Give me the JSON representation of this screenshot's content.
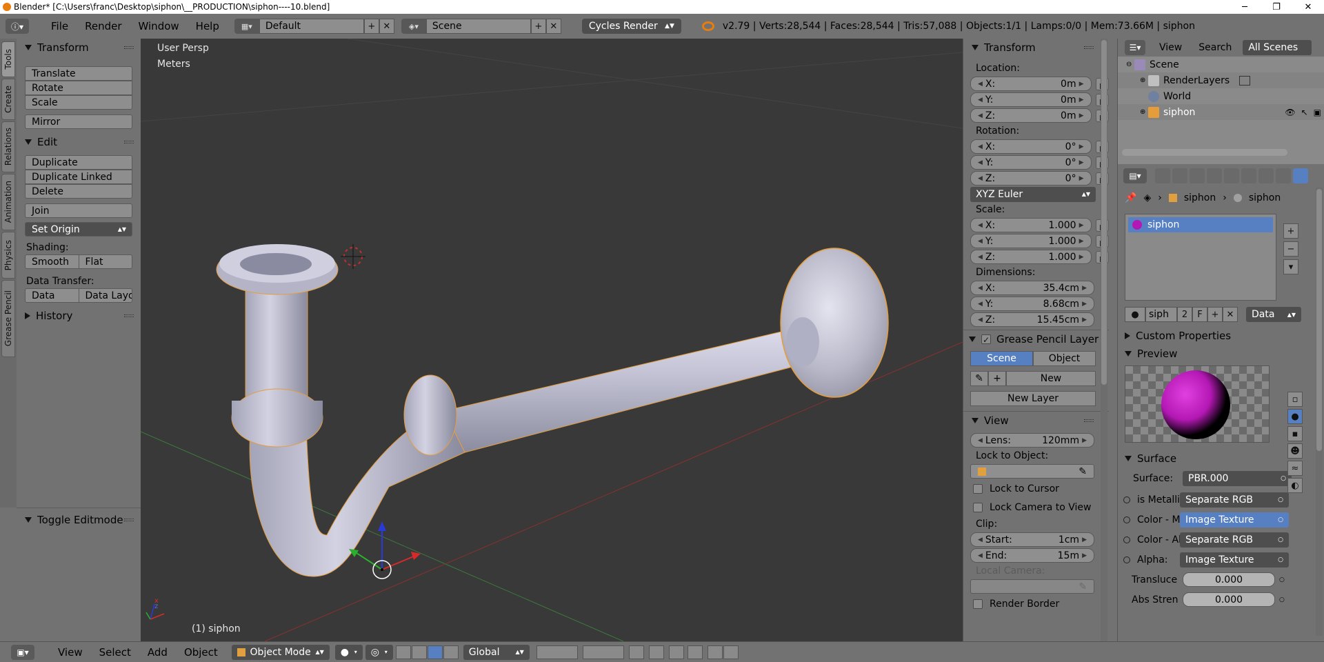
{
  "window": {
    "title": "Blender* [C:\\Users\\franc\\Desktop\\siphon\\__PRODUCTION\\siphon----10.blend]",
    "minimize": "─",
    "maximize": "❐",
    "close": "✕"
  },
  "info_header": {
    "menus": [
      "File",
      "Render",
      "Window",
      "Help"
    ],
    "screen_layout": "Default",
    "scene": "Scene",
    "render_engine": "Cycles Render",
    "stats": "v2.79 | Verts:28,544 | Faces:28,544 | Tris:57,088 | Objects:1/1 | Lamps:0/0 | Mem:73.66M | siphon"
  },
  "tool_tabs": [
    "Tools",
    "Create",
    "Relations",
    "Animation",
    "Physics",
    "Grease Pencil"
  ],
  "toolshelf": {
    "transform": {
      "title": "Transform",
      "buttons": [
        "Translate",
        "Rotate",
        "Scale",
        "Mirror"
      ]
    },
    "edit": {
      "title": "Edit",
      "buttons": [
        "Duplicate",
        "Duplicate Linked",
        "Delete",
        "Join"
      ],
      "set_origin": "Set Origin",
      "shading_label": "Shading:",
      "shading": [
        "Smooth",
        "Flat"
      ],
      "data_transfer_label": "Data Transfer:",
      "data_transfer": [
        "Data",
        "Data Layo"
      ]
    },
    "history": {
      "title": "History"
    },
    "operator": {
      "title": "Toggle Editmode"
    }
  },
  "viewport": {
    "view_name": "User Persp",
    "units": "Meters",
    "active_object": "(1) siphon",
    "axis_x": "x",
    "axis_z": "z"
  },
  "npanel": {
    "transform": {
      "title": "Transform",
      "location_label": "Location:",
      "location": [
        {
          "axis": "X:",
          "value": "0m"
        },
        {
          "axis": "Y:",
          "value": "0m"
        },
        {
          "axis": "Z:",
          "value": "0m"
        }
      ],
      "rotation_label": "Rotation:",
      "rotation": [
        {
          "axis": "X:",
          "value": "0°"
        },
        {
          "axis": "Y:",
          "value": "0°"
        },
        {
          "axis": "Z:",
          "value": "0°"
        }
      ],
      "rotation_mode": "XYZ Euler",
      "scale_label": "Scale:",
      "scale": [
        {
          "axis": "X:",
          "value": "1.000"
        },
        {
          "axis": "Y:",
          "value": "1.000"
        },
        {
          "axis": "Z:",
          "value": "1.000"
        }
      ],
      "dimensions_label": "Dimensions:",
      "dimensions": [
        {
          "axis": "X:",
          "value": "35.4cm"
        },
        {
          "axis": "Y:",
          "value": "8.68cm"
        },
        {
          "axis": "Z:",
          "value": "15.45cm"
        }
      ]
    },
    "grease_pencil": {
      "title": "Grease Pencil Layer",
      "modes": [
        "Scene",
        "Object"
      ],
      "new_label": "New",
      "new_layer": "New Layer"
    },
    "view": {
      "title": "View",
      "lens_label": "Lens:",
      "lens": "120mm",
      "lock_object_label": "Lock to Object:",
      "lock_cursor": "Lock to Cursor",
      "lock_camera": "Lock Camera to View",
      "clip_label": "Clip:",
      "clip_start_label": "Start:",
      "clip_start": "1cm",
      "clip_end_label": "End:",
      "clip_end": "15m",
      "local_camera_label": "Local Camera:",
      "render_border": "Render Border"
    }
  },
  "outliner": {
    "menus": [
      "View",
      "Search"
    ],
    "filter": "All Scenes",
    "items": [
      {
        "label": "Scene"
      },
      {
        "label": "RenderLayers"
      },
      {
        "label": "World"
      },
      {
        "label": "siphon"
      }
    ]
  },
  "properties": {
    "breadcrumb": [
      "siphon",
      "siphon"
    ],
    "slot": "siphon",
    "material_name": "siph",
    "users": "2",
    "fake_user": "F",
    "link": "Data",
    "custom_props": "Custom Properties",
    "preview": "Preview",
    "surface_panel": "Surface",
    "surface_label": "Surface:",
    "surface_value": "PBR.000",
    "inputs": [
      {
        "label": "is Metallic",
        "value": "Separate RGB",
        "type": "link"
      },
      {
        "label": "Color - Ma",
        "value": "Image Texture",
        "type": "link"
      },
      {
        "label": "Color - Ab",
        "value": "Separate RGB",
        "type": "link"
      },
      {
        "label": "Alpha:",
        "value": "Image Texture",
        "type": "link"
      },
      {
        "label": "Transluce",
        "value": "0.000",
        "type": "num"
      },
      {
        "label": "Abs Stren",
        "value": "0.000",
        "type": "num"
      }
    ]
  },
  "bottom_bar": {
    "menus": [
      "View",
      "Select",
      "Add",
      "Object"
    ],
    "mode": "Object Mode",
    "orientation": "Global"
  },
  "colors": {
    "selected_blue": "#5680c2",
    "selection_orange": "#e59d3b",
    "viewport_bg": "#393939",
    "material_magenta": "#b418b4"
  }
}
